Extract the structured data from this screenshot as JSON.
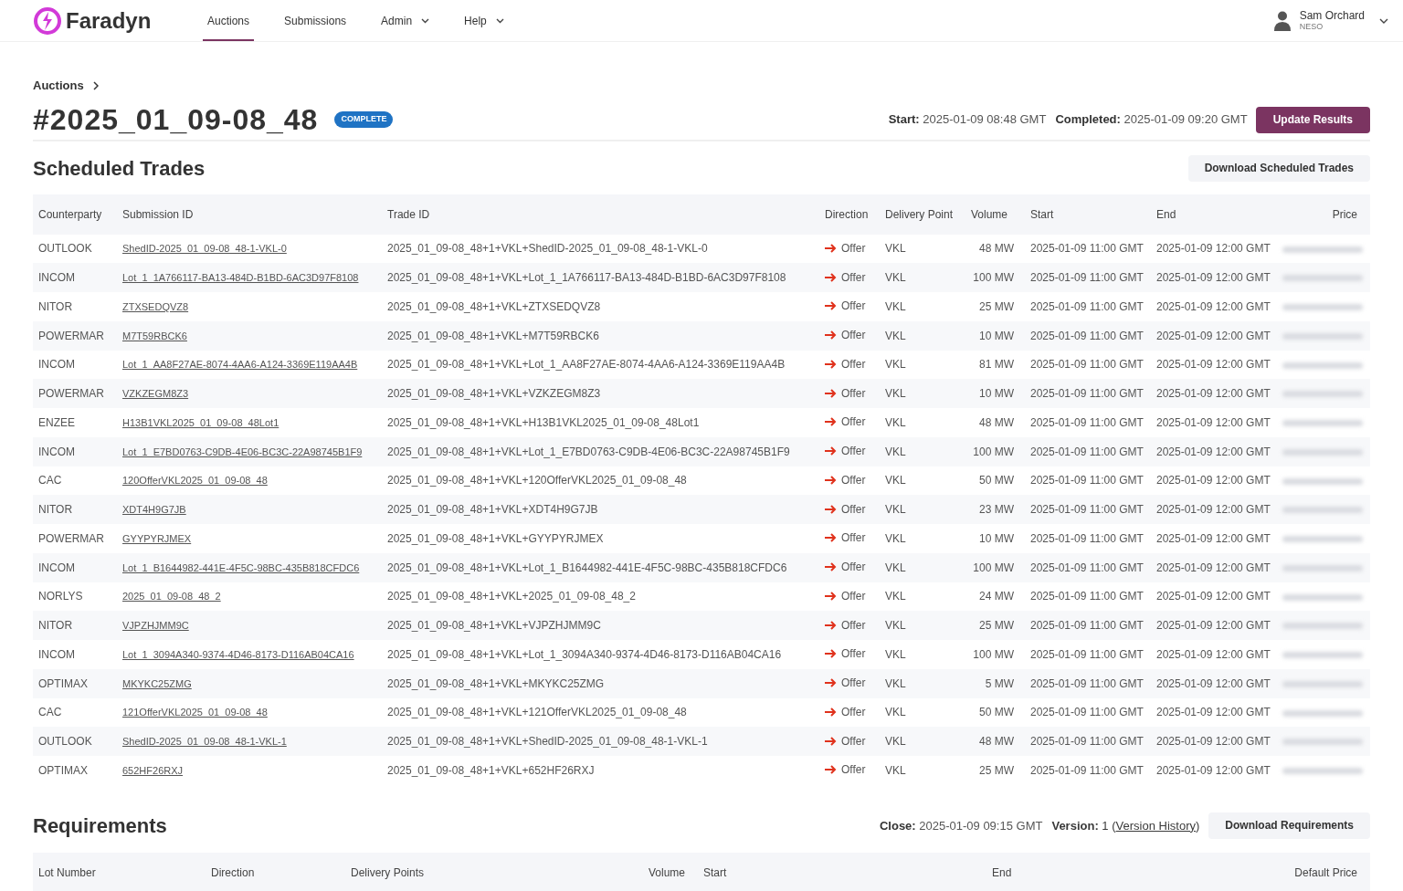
{
  "brand": "Faradyn",
  "nav": [
    {
      "label": "Auctions",
      "selected": true,
      "dropdown": false
    },
    {
      "label": "Submissions",
      "selected": false,
      "dropdown": false
    },
    {
      "label": "Admin",
      "selected": false,
      "dropdown": true
    },
    {
      "label": "Help",
      "selected": false,
      "dropdown": true
    }
  ],
  "user": {
    "name": "Sam Orchard",
    "org": "NESO"
  },
  "breadcrumb": "Auctions",
  "title": "#2025_01_09-08_48",
  "status_badge": "COMPLETE",
  "meta": [
    {
      "label": "Start:",
      "value": "2025-01-09 08:48 GMT"
    },
    {
      "label": "Completed:",
      "value": "2025-01-09 09:20 GMT"
    }
  ],
  "update_button": "Update Results",
  "scheduled_trades": {
    "heading": "Scheduled Trades",
    "download_button": "Download Scheduled Trades",
    "columns": [
      "Counterparty",
      "Submission ID",
      "Trade ID",
      "Direction",
      "Delivery Point",
      "Volume",
      "Start",
      "End",
      "Price"
    ],
    "rows": [
      {
        "counterparty": "OUTLOOK",
        "submission_id": "ShedID-2025_01_09-08_48-1-VKL-0",
        "trade_id": "2025_01_09-08_48+1+VKL+ShedID-2025_01_09-08_48-1-VKL-0",
        "direction": "Offer",
        "delivery_point": "VKL",
        "volume": "48 MW",
        "start": "2025-01-09 11:00 GMT",
        "end": "2025-01-09 12:00 GMT",
        "price_blurred": true
      },
      {
        "counterparty": "INCOM",
        "submission_id": "Lot_1_1A766117-BA13-484D-B1BD-6AC3D97F8108",
        "trade_id": "2025_01_09-08_48+1+VKL+Lot_1_1A766117-BA13-484D-B1BD-6AC3D97F8108",
        "direction": "Offer",
        "delivery_point": "VKL",
        "volume": "100 MW",
        "start": "2025-01-09 11:00 GMT",
        "end": "2025-01-09 12:00 GMT",
        "price_blurred": true
      },
      {
        "counterparty": "NITOR",
        "submission_id": "ZTXSEDQVZ8",
        "trade_id": "2025_01_09-08_48+1+VKL+ZTXSEDQVZ8",
        "direction": "Offer",
        "delivery_point": "VKL",
        "volume": "25 MW",
        "start": "2025-01-09 11:00 GMT",
        "end": "2025-01-09 12:00 GMT",
        "price_blurred": true
      },
      {
        "counterparty": "POWERMAR",
        "submission_id": "M7T59RBCK6",
        "trade_id": "2025_01_09-08_48+1+VKL+M7T59RBCK6",
        "direction": "Offer",
        "delivery_point": "VKL",
        "volume": "10 MW",
        "start": "2025-01-09 11:00 GMT",
        "end": "2025-01-09 12:00 GMT",
        "price_blurred": true
      },
      {
        "counterparty": "INCOM",
        "submission_id": "Lot_1_AA8F27AE-8074-4AA6-A124-3369E119AA4B",
        "trade_id": "2025_01_09-08_48+1+VKL+Lot_1_AA8F27AE-8074-4AA6-A124-3369E119AA4B",
        "direction": "Offer",
        "delivery_point": "VKL",
        "volume": "81 MW",
        "start": "2025-01-09 11:00 GMT",
        "end": "2025-01-09 12:00 GMT",
        "price_blurred": true
      },
      {
        "counterparty": "POWERMAR",
        "submission_id": "VZKZEGM8Z3",
        "trade_id": "2025_01_09-08_48+1+VKL+VZKZEGM8Z3",
        "direction": "Offer",
        "delivery_point": "VKL",
        "volume": "10 MW",
        "start": "2025-01-09 11:00 GMT",
        "end": "2025-01-09 12:00 GMT",
        "price_blurred": true
      },
      {
        "counterparty": "ENZEE",
        "submission_id": "H13B1VKL2025_01_09-08_48Lot1",
        "trade_id": "2025_01_09-08_48+1+VKL+H13B1VKL2025_01_09-08_48Lot1",
        "direction": "Offer",
        "delivery_point": "VKL",
        "volume": "48 MW",
        "start": "2025-01-09 11:00 GMT",
        "end": "2025-01-09 12:00 GMT",
        "price_blurred": true
      },
      {
        "counterparty": "INCOM",
        "submission_id": "Lot_1_E7BD0763-C9DB-4E06-BC3C-22A98745B1F9",
        "trade_id": "2025_01_09-08_48+1+VKL+Lot_1_E7BD0763-C9DB-4E06-BC3C-22A98745B1F9",
        "direction": "Offer",
        "delivery_point": "VKL",
        "volume": "100 MW",
        "start": "2025-01-09 11:00 GMT",
        "end": "2025-01-09 12:00 GMT",
        "price_blurred": true
      },
      {
        "counterparty": "CAC",
        "submission_id": "120OfferVKL2025_01_09-08_48",
        "trade_id": "2025_01_09-08_48+1+VKL+120OfferVKL2025_01_09-08_48",
        "direction": "Offer",
        "delivery_point": "VKL",
        "volume": "50 MW",
        "start": "2025-01-09 11:00 GMT",
        "end": "2025-01-09 12:00 GMT",
        "price_blurred": true
      },
      {
        "counterparty": "NITOR",
        "submission_id": "XDT4H9G7JB",
        "trade_id": "2025_01_09-08_48+1+VKL+XDT4H9G7JB",
        "direction": "Offer",
        "delivery_point": "VKL",
        "volume": "23 MW",
        "start": "2025-01-09 11:00 GMT",
        "end": "2025-01-09 12:00 GMT",
        "price_blurred": true
      },
      {
        "counterparty": "POWERMAR",
        "submission_id": "GYYPYRJMEX",
        "trade_id": "2025_01_09-08_48+1+VKL+GYYPYRJMEX",
        "direction": "Offer",
        "delivery_point": "VKL",
        "volume": "10 MW",
        "start": "2025-01-09 11:00 GMT",
        "end": "2025-01-09 12:00 GMT",
        "price_blurred": true
      },
      {
        "counterparty": "INCOM",
        "submission_id": "Lot_1_B1644982-441E-4F5C-98BC-435B818CFDC6",
        "trade_id": "2025_01_09-08_48+1+VKL+Lot_1_B1644982-441E-4F5C-98BC-435B818CFDC6",
        "direction": "Offer",
        "delivery_point": "VKL",
        "volume": "100 MW",
        "start": "2025-01-09 11:00 GMT",
        "end": "2025-01-09 12:00 GMT",
        "price_blurred": true
      },
      {
        "counterparty": "NORLYS",
        "submission_id": "2025_01_09-08_48_2",
        "trade_id": "2025_01_09-08_48+1+VKL+2025_01_09-08_48_2",
        "direction": "Offer",
        "delivery_point": "VKL",
        "volume": "24 MW",
        "start": "2025-01-09 11:00 GMT",
        "end": "2025-01-09 12:00 GMT",
        "price_blurred": true
      },
      {
        "counterparty": "NITOR",
        "submission_id": "VJPZHJMM9C",
        "trade_id": "2025_01_09-08_48+1+VKL+VJPZHJMM9C",
        "direction": "Offer",
        "delivery_point": "VKL",
        "volume": "25 MW",
        "start": "2025-01-09 11:00 GMT",
        "end": "2025-01-09 12:00 GMT",
        "price_blurred": true
      },
      {
        "counterparty": "INCOM",
        "submission_id": "Lot_1_3094A340-9374-4D46-8173-D116AB04CA16",
        "trade_id": "2025_01_09-08_48+1+VKL+Lot_1_3094A340-9374-4D46-8173-D116AB04CA16",
        "direction": "Offer",
        "delivery_point": "VKL",
        "volume": "100 MW",
        "start": "2025-01-09 11:00 GMT",
        "end": "2025-01-09 12:00 GMT",
        "price_blurred": true
      },
      {
        "counterparty": "OPTIMAX",
        "submission_id": "MKYKC25ZMG",
        "trade_id": "2025_01_09-08_48+1+VKL+MKYKC25ZMG",
        "direction": "Offer",
        "delivery_point": "VKL",
        "volume": "5 MW",
        "start": "2025-01-09 11:00 GMT",
        "end": "2025-01-09 12:00 GMT",
        "price_blurred": true
      },
      {
        "counterparty": "CAC",
        "submission_id": "121OfferVKL2025_01_09-08_48",
        "trade_id": "2025_01_09-08_48+1+VKL+121OfferVKL2025_01_09-08_48",
        "direction": "Offer",
        "delivery_point": "VKL",
        "volume": "50 MW",
        "start": "2025-01-09 11:00 GMT",
        "end": "2025-01-09 12:00 GMT",
        "price_blurred": true
      },
      {
        "counterparty": "OUTLOOK",
        "submission_id": "ShedID-2025_01_09-08_48-1-VKL-1",
        "trade_id": "2025_01_09-08_48+1+VKL+ShedID-2025_01_09-08_48-1-VKL-1",
        "direction": "Offer",
        "delivery_point": "VKL",
        "volume": "48 MW",
        "start": "2025-01-09 11:00 GMT",
        "end": "2025-01-09 12:00 GMT",
        "price_blurred": true
      },
      {
        "counterparty": "OPTIMAX",
        "submission_id": "652HF26RXJ",
        "trade_id": "2025_01_09-08_48+1+VKL+652HF26RXJ",
        "direction": "Offer",
        "delivery_point": "VKL",
        "volume": "25 MW",
        "start": "2025-01-09 11:00 GMT",
        "end": "2025-01-09 12:00 GMT",
        "price_blurred": true
      }
    ]
  },
  "requirements": {
    "heading": "Requirements",
    "close_label": "Close:",
    "close_value": "2025-01-09 09:15 GMT",
    "version_label": "Version:",
    "version_value": "1",
    "open_paren": "(",
    "version_history_link": "Version History",
    "close_paren": ")",
    "download_button": "Download Requirements",
    "columns": [
      "Lot Number",
      "Direction",
      "Delivery Points",
      "Volume",
      "Start",
      "End",
      "Default Price"
    ]
  }
}
